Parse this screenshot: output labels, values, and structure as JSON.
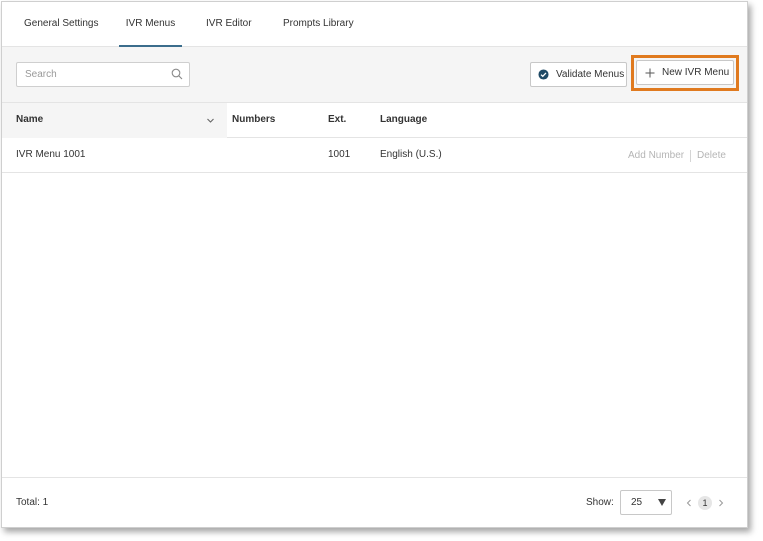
{
  "tabs": [
    {
      "label": "General Settings",
      "active": false
    },
    {
      "label": "IVR Menus",
      "active": true
    },
    {
      "label": "IVR Editor",
      "active": false
    },
    {
      "label": "Prompts Library",
      "active": false
    }
  ],
  "toolbar": {
    "search_placeholder": "Search",
    "search_value": "",
    "validate_label": "Validate Menus",
    "new_label": "New IVR Menu"
  },
  "table": {
    "columns": [
      "Name",
      "Numbers",
      "Ext.",
      "Language"
    ],
    "rows": [
      {
        "name": "IVR Menu 1001",
        "numbers": "",
        "ext": "1001",
        "language": "English (U.S.)"
      }
    ],
    "row_actions": [
      "Add Number",
      "Delete"
    ]
  },
  "footer": {
    "total": "Total: 1",
    "show_label": "Show:",
    "page_size": "25",
    "current_page": "1"
  },
  "colors": {
    "accent": "#3b6d8c",
    "highlight": "#e07a1f",
    "check_icon": "#1f4a66"
  },
  "icons": [
    "search-icon",
    "check-circle-icon",
    "plus-icon",
    "chevron-down-icon",
    "caret-down-icon",
    "chevron-left-icon",
    "chevron-right-icon"
  ]
}
